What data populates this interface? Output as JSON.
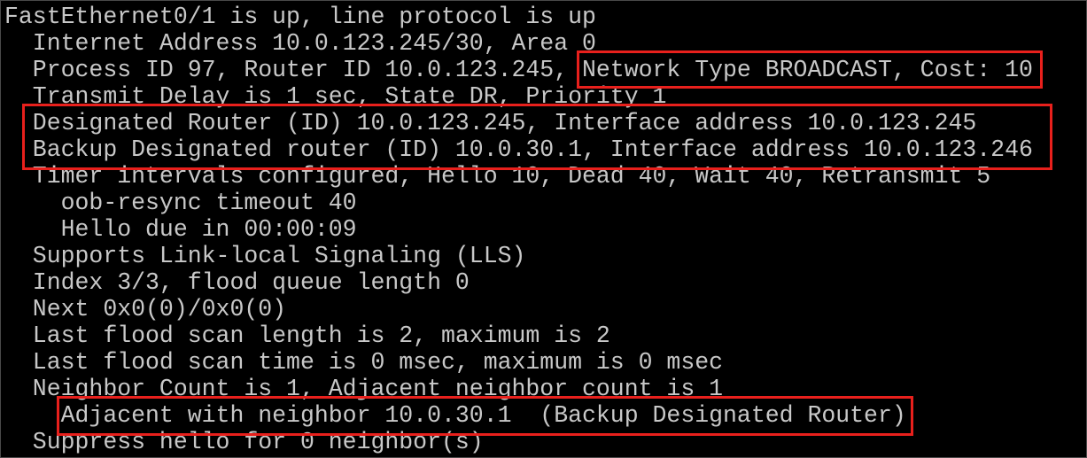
{
  "terminal": {
    "lines": [
      "FastEthernet0/1 is up, line protocol is up",
      "  Internet Address 10.0.123.245/30, Area 0",
      "  Process ID 97, Router ID 10.0.123.245, Network Type BROADCAST, Cost: 10",
      "  Transmit Delay is 1 sec, State DR, Priority 1",
      "  Designated Router (ID) 10.0.123.245, Interface address 10.0.123.245",
      "  Backup Designated router (ID) 10.0.30.1, Interface address 10.0.123.246",
      "  Timer intervals configured, Hello 10, Dead 40, Wait 40, Retransmit 5",
      "    oob-resync timeout 40",
      "    Hello due in 00:00:09",
      "  Supports Link-local Signaling (LLS)",
      "  Index 3/3, flood queue length 0",
      "  Next 0x0(0)/0x0(0)",
      "  Last flood scan length is 2, maximum is 2",
      "  Last flood scan time is 0 msec, maximum is 0 msec",
      "  Neighbor Count is 1, Adjacent neighbor count is 1",
      "    Adjacent with neighbor 10.0.30.1  (Backup Designated Router)",
      "  Suppress hello for 0 neighbor(s)"
    ]
  },
  "colors": {
    "background": "#000000",
    "text": "#c8c8c8",
    "highlight_border": "#e8201c",
    "window_border": "#4a4a4a"
  }
}
